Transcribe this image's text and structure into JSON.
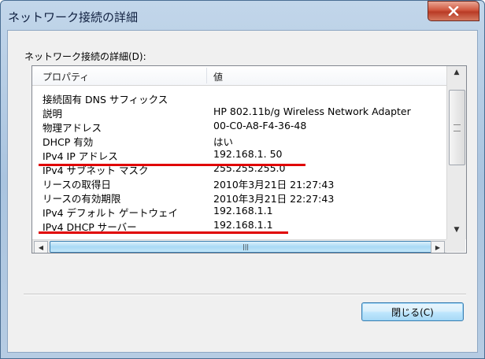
{
  "window": {
    "title": "ネットワーク接続の詳細",
    "close_icon": "x-icon"
  },
  "group_label": "ネットワーク接続の詳細(D):",
  "list": {
    "columns": [
      "プロパティ",
      "値"
    ],
    "rows": [
      {
        "property": "接続固有 DNS サフィックス",
        "value": ""
      },
      {
        "property": "説明",
        "value": "HP 802.11b/g Wireless Network Adapter"
      },
      {
        "property": "物理アドレス",
        "value": "00-C0-A8-F4-36-48"
      },
      {
        "property": "DHCP 有効",
        "value": "はい"
      },
      {
        "property": "IPv4 IP アドレス",
        "value": "192.168.1. 50"
      },
      {
        "property": "IPv4 サブネット マスク",
        "value": "255.255.255.0"
      },
      {
        "property": "リースの取得日",
        "value": "2010年3月21日 21:27:43"
      },
      {
        "property": "リースの有効期限",
        "value": "2010年3月21日 22:27:43"
      },
      {
        "property": "IPv4 デフォルト ゲートウェイ",
        "value": "192.168.1.1"
      },
      {
        "property": "IPv4 DHCP サーバー",
        "value": "192.168.1.1"
      }
    ]
  },
  "buttons": {
    "close_label": "閉じる(C)"
  },
  "colors": {
    "highlight_underline": "#e00000",
    "button_border": "#3c7fb1"
  }
}
